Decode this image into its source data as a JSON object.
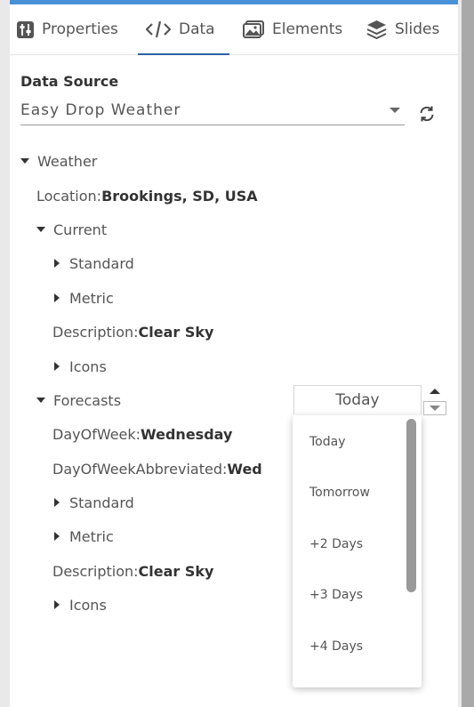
{
  "tabs": [
    {
      "label": "Properties",
      "icon": "sliders-icon"
    },
    {
      "label": "Data",
      "icon": "code-icon"
    },
    {
      "label": "Elements",
      "icon": "image-icon"
    },
    {
      "label": "Slides",
      "icon": "layers-icon"
    }
  ],
  "active_tab": "Data",
  "data_source": {
    "title": "Data Source",
    "selected": "Easy Drop Weather"
  },
  "tree": {
    "weather_label": "Weather",
    "location": {
      "key": "Location:",
      "value": "Brookings, SD, USA"
    },
    "current": {
      "label": "Current",
      "standard": "Standard",
      "metric": "Metric",
      "description": {
        "key": "Description:",
        "value": "Clear Sky"
      },
      "icons": "Icons"
    },
    "forecasts": {
      "label": "Forecasts",
      "day_of_week": {
        "key": "DayOfWeek:",
        "value": "Wednesday"
      },
      "day_of_week_abbr": {
        "key": "DayOfWeekAbbreviated:",
        "value": "Wed"
      },
      "standard": "Standard",
      "metric": "Metric",
      "description": {
        "key": "Description:",
        "value": "Clear Sky"
      },
      "icons": "Icons"
    }
  },
  "forecast_select": {
    "value": "Today",
    "options": [
      "Today",
      "Tomorrow",
      "+2 Days",
      "+3 Days",
      "+4 Days"
    ]
  },
  "colors": {
    "accent": "#2f5fa8",
    "topbar": "#4a90d9"
  }
}
